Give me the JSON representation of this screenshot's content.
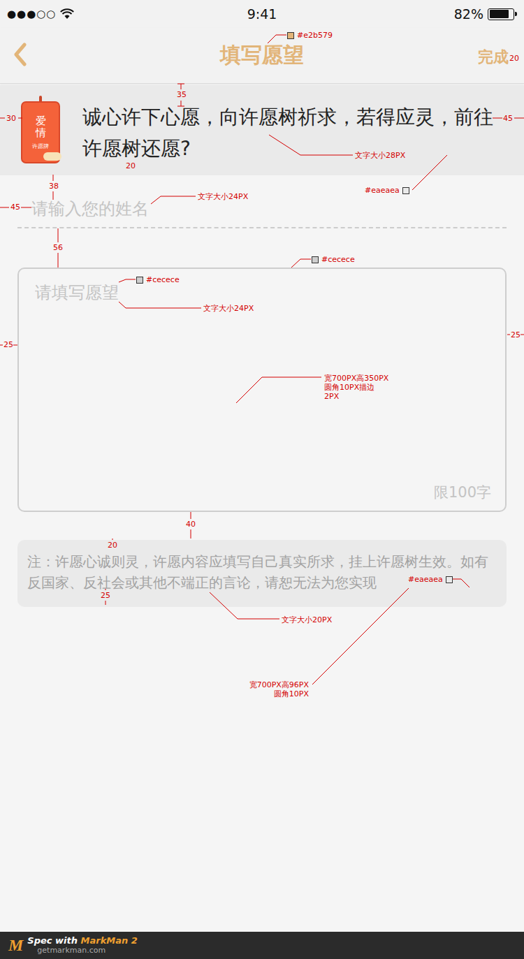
{
  "status_bar": {
    "signal": "●●●○○",
    "time": "9:41",
    "battery": "82%",
    "battery_level": 0.82
  },
  "nav": {
    "title": "填写愿望",
    "action": "完成"
  },
  "intro": {
    "tag_title": "爱情",
    "tag_sub": "许愿牌",
    "text": "诚心许下心愿，向许愿树祈求，若得应灵，前往许愿树还愿?"
  },
  "name_field": {
    "placeholder": "请输入您的姓名"
  },
  "wish_field": {
    "placeholder": "请填写愿望",
    "limit": "限100字"
  },
  "note": {
    "text": "注：许愿心诚则灵，许愿内容应填写自己真实所求，挂上许愿树生效。如有反国家、反社会或其他不端正的言论，请恕无法为您实现"
  },
  "annotations": [
    {
      "lines": [
        "#e2b579"
      ],
      "color": "#e2b579"
    },
    {
      "lines": [
        "35"
      ]
    },
    {
      "lines": [
        "30"
      ]
    },
    {
      "lines": [
        "45"
      ]
    },
    {
      "lines": [
        "20"
      ]
    },
    {
      "lines": [
        "文字大小28PX"
      ]
    },
    {
      "lines": [
        "20"
      ]
    },
    {
      "lines": [
        "38"
      ]
    },
    {
      "lines": [
        "#eaeaea"
      ],
      "color": "#eaeaea"
    },
    {
      "lines": [
        "45"
      ]
    },
    {
      "lines": [
        "文字大小24PX"
      ]
    },
    {
      "lines": [
        "56"
      ]
    },
    {
      "lines": [
        "#cecece"
      ],
      "color": "#cecece"
    },
    {
      "lines": [
        "#cecece"
      ],
      "color": "#cecece"
    },
    {
      "lines": [
        "文字大小24PX"
      ]
    },
    {
      "lines": [
        "25"
      ]
    },
    {
      "lines": [
        "25"
      ]
    },
    {
      "lines": [
        "宽700PX高350PX",
        "圆角10PX描边",
        "2PX"
      ]
    },
    {
      "lines": [
        "40"
      ]
    },
    {
      "lines": [
        "20"
      ]
    },
    {
      "lines": [
        "25"
      ]
    },
    {
      "lines": [
        "#eaeaea"
      ],
      "color": "#eaeaea"
    },
    {
      "lines": [
        "文字大小20PX"
      ]
    },
    {
      "lines": [
        "宽700PX高96PX",
        "圆角10PX"
      ]
    }
  ],
  "footer": {
    "logo": "M",
    "spec": "Spec with ",
    "product": "MarkMan 2",
    "site": "getmarkman.com"
  }
}
